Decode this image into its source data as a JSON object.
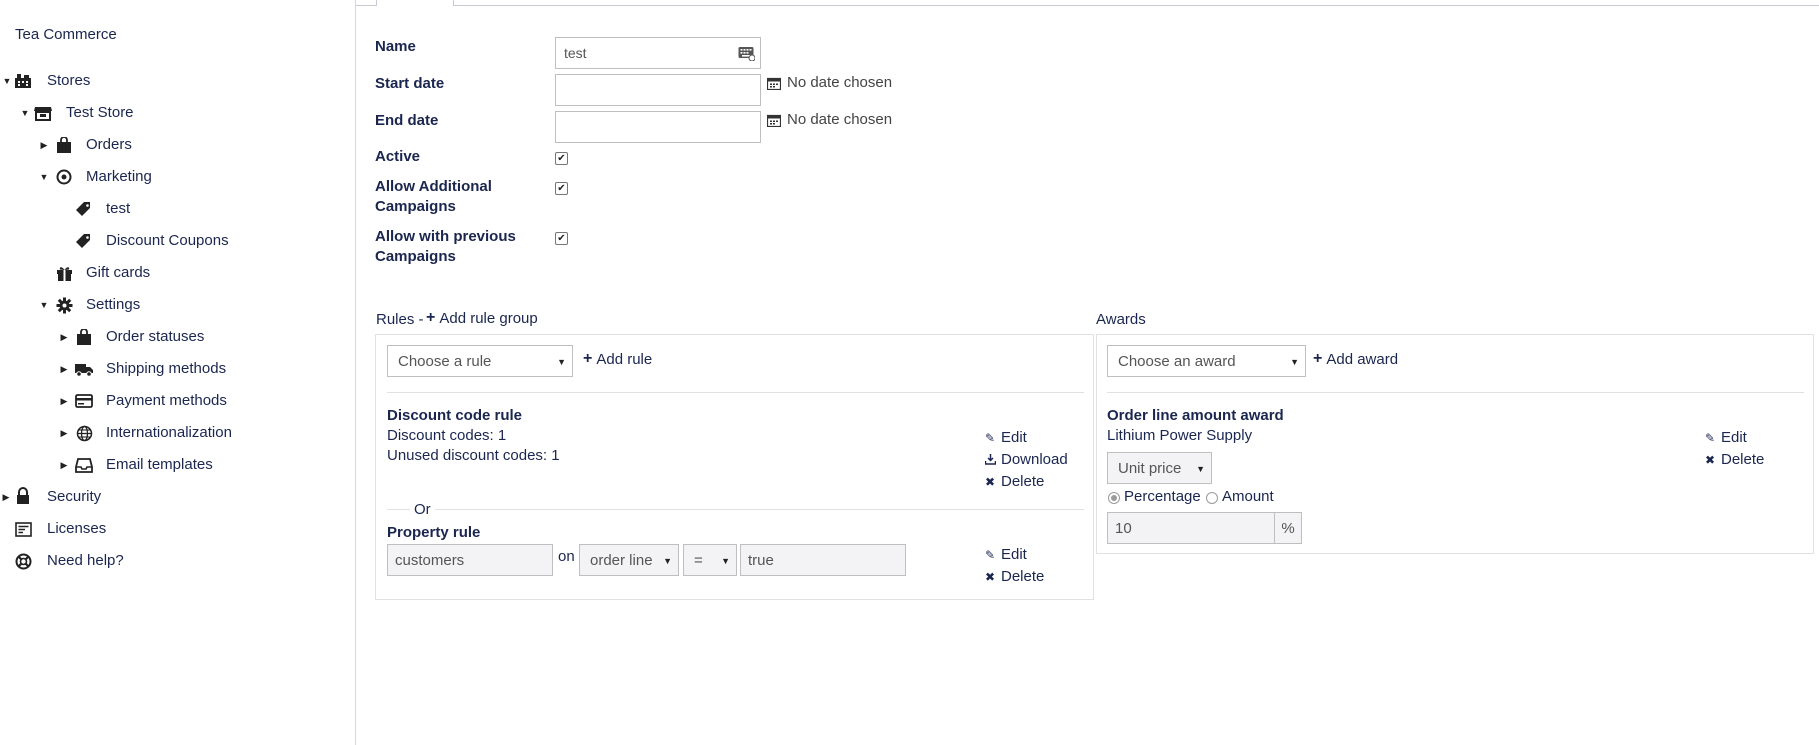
{
  "app": {
    "title": "Tea Commerce"
  },
  "tree": {
    "stores": "Stores",
    "test_store": "Test Store",
    "orders": "Orders",
    "marketing": "Marketing",
    "test": "test",
    "discount_coupons": "Discount Coupons",
    "gift_cards": "Gift cards",
    "settings": "Settings",
    "order_statuses": "Order statuses",
    "shipping_methods": "Shipping methods",
    "payment_methods": "Payment methods",
    "internationalization": "Internationalization",
    "email_templates": "Email templates",
    "security": "Security",
    "licenses": "Licenses",
    "need_help": "Need help?"
  },
  "form": {
    "name_label": "Name",
    "name_value": "test",
    "start_date_label": "Start date",
    "end_date_label": "End date",
    "no_date": "No date chosen",
    "active_label": "Active",
    "allow_additional_label_1": "Allow Additional",
    "allow_additional_label_2": "Campaigns",
    "allow_previous_label_1": "Allow with previous",
    "allow_previous_label_2": "Campaigns",
    "active_checked": true,
    "allow_additional_checked": true,
    "allow_previous_checked": true
  },
  "rules": {
    "title": "Rules -",
    "add_rule_group": "Add rule group",
    "choose_rule": "Choose a rule",
    "add_rule": "Add rule",
    "discount_rule_title": "Discount code rule",
    "discount_codes": "Discount codes: 1",
    "unused_codes": "Unused discount codes: 1",
    "edit": "Edit",
    "download": "Download",
    "delete": "Delete",
    "or": "Or",
    "property_rule_title": "Property rule",
    "property_field": "customers",
    "on": "on",
    "scope": "order line",
    "operator": "=",
    "value": "true"
  },
  "awards": {
    "title": "Awards",
    "choose_award": "Choose an award",
    "add_award": "Add award",
    "award_title": "Order line amount award",
    "product": "Lithium Power Supply",
    "price_type": "Unit price",
    "percentage": "Percentage",
    "amount": "Amount",
    "selected_mode": "Percentage",
    "value": "10",
    "unit": "%",
    "edit": "Edit",
    "delete": "Delete"
  }
}
